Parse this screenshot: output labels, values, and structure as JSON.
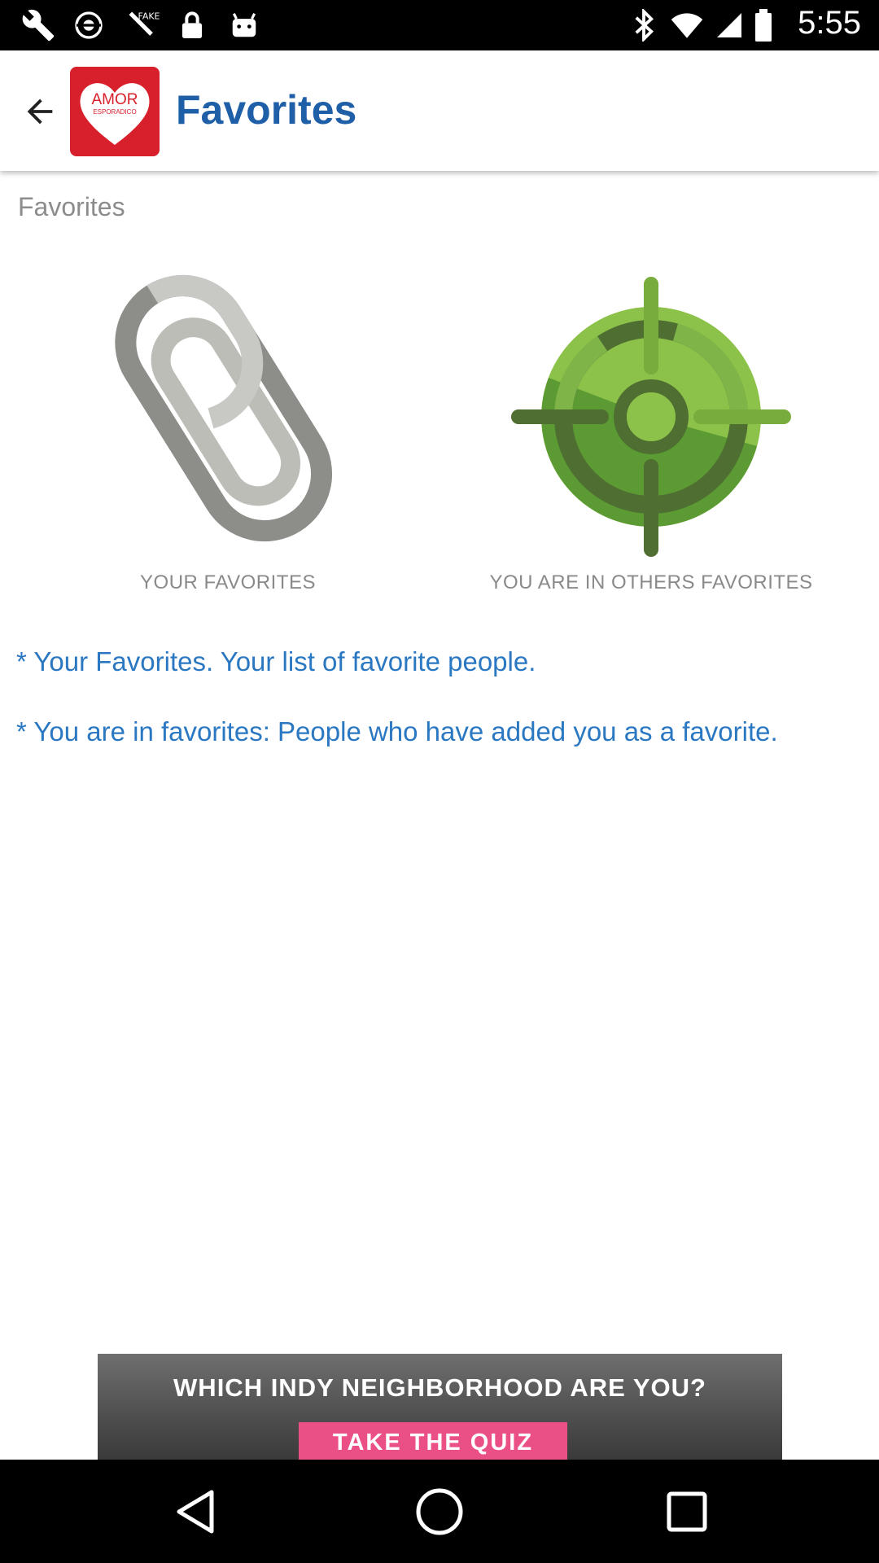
{
  "status_bar": {
    "time": "5:55",
    "icons": [
      "wrench-icon",
      "fake-gps-icon",
      "satellite-icon",
      "lock-icon",
      "android-icon",
      "bluetooth-icon",
      "wifi-icon",
      "signal-icon",
      "battery-icon"
    ]
  },
  "app_bar": {
    "title": "Favorites",
    "logo_text_top": "AMOR",
    "logo_text_bottom": "ESPORADICO",
    "title_color": "#1f5fa8",
    "logo_color": "#d7202b"
  },
  "content": {
    "section_label": "Favorites",
    "tiles": [
      {
        "label": "YOUR FAVORITES",
        "icon": "paperclip-icon"
      },
      {
        "label": "YOU ARE IN OTHERS FAVORITES",
        "icon": "target-icon"
      }
    ],
    "notes": [
      "* Your Favorites. Your list of favorite people.",
      "* You are in favorites: People who have added you as a favorite."
    ],
    "note_color": "#2b78c2"
  },
  "ad": {
    "headline": "WHICH INDY NEIGHBORHOOD ARE YOU?",
    "cta": "TAKE THE QUIZ"
  },
  "nav_bar": {
    "buttons": [
      "back-triangle-icon",
      "home-circle-icon",
      "recents-square-icon"
    ]
  }
}
